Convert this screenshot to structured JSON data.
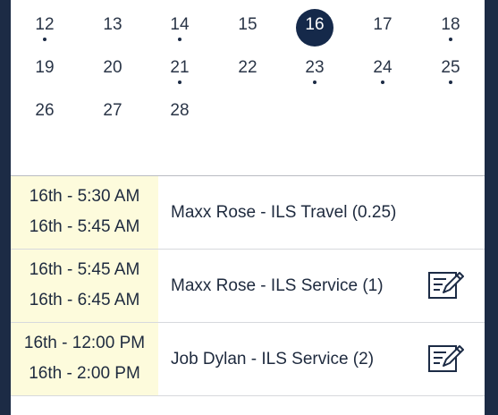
{
  "calendar": {
    "selected_day": "16",
    "weeks": [
      [
        {
          "label": "12",
          "has_event": true
        },
        {
          "label": "13",
          "has_event": false
        },
        {
          "label": "14",
          "has_event": true
        },
        {
          "label": "15",
          "has_event": false
        },
        {
          "label": "16",
          "has_event": false,
          "selected": true
        },
        {
          "label": "17",
          "has_event": false
        },
        {
          "label": "18",
          "has_event": true
        }
      ],
      [
        {
          "label": "19",
          "has_event": false
        },
        {
          "label": "20",
          "has_event": false
        },
        {
          "label": "21",
          "has_event": true
        },
        {
          "label": "22",
          "has_event": false
        },
        {
          "label": "23",
          "has_event": true
        },
        {
          "label": "24",
          "has_event": true
        },
        {
          "label": "25",
          "has_event": true
        }
      ],
      [
        {
          "label": "26",
          "has_event": false
        },
        {
          "label": "27",
          "has_event": false
        },
        {
          "label": "28",
          "has_event": false
        }
      ]
    ]
  },
  "events": [
    {
      "start": "16th - 5:30 AM",
      "end": "16th - 5:45 AM",
      "title": "Maxx Rose - ILS Travel (0.25)",
      "editable": false
    },
    {
      "start": "16th - 5:45 AM",
      "end": "16th - 6:45 AM",
      "title": "Maxx Rose - ILS Service (1)",
      "editable": true,
      "icon": "edit-icon"
    },
    {
      "start": "16th - 12:00 PM",
      "end": "16th - 2:00 PM",
      "title": "Job Dylan - ILS Service (2)",
      "editable": true,
      "icon": "edit-icon"
    }
  ],
  "colors": {
    "frame_border": "#1c2b45",
    "selected_day_bg": "#15294a",
    "time_cell_bg": "#fdfbdc",
    "text": "#1e2a3e"
  }
}
